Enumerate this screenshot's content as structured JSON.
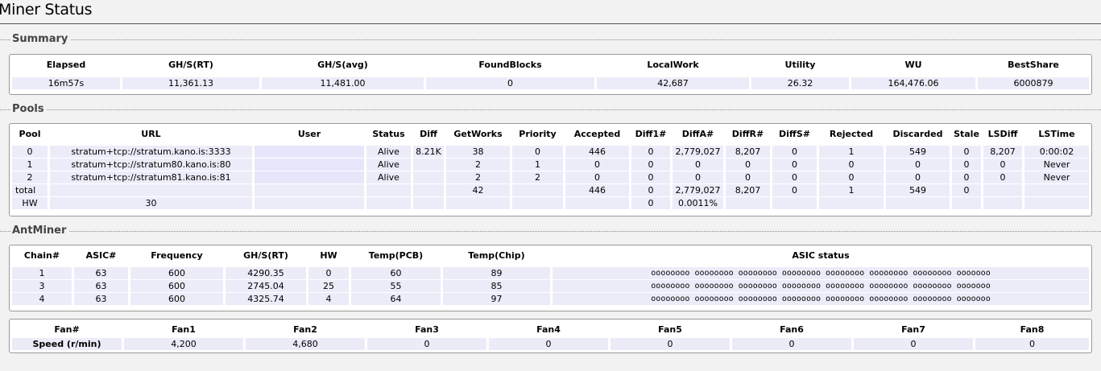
{
  "page": {
    "title": "Miner Status"
  },
  "summary": {
    "legend": "Summary",
    "headers": [
      "Elapsed",
      "GH/S(RT)",
      "GH/S(avg)",
      "FoundBlocks",
      "LocalWork",
      "Utility",
      "WU",
      "BestShare"
    ],
    "values": [
      "16m57s",
      "11,361.13",
      "11,481.00",
      "0",
      "42,687",
      "26.32",
      "164,476.06",
      "6000879"
    ]
  },
  "pools": {
    "legend": "Pools",
    "headers": [
      "Pool",
      "URL",
      "User",
      "Status",
      "Diff",
      "GetWorks",
      "Priority",
      "Accepted",
      "Diff1#",
      "DiffA#",
      "DiffR#",
      "DiffS#",
      "Rejected",
      "Discarded",
      "Stale",
      "LSDiff",
      "LSTime"
    ],
    "rows": [
      [
        "0",
        "stratum+tcp://stratum.kano.is:3333",
        "",
        "Alive",
        "8.21K",
        "38",
        "0",
        "446",
        "0",
        "2,779,027",
        "8,207",
        "0",
        "1",
        "549",
        "0",
        "8,207",
        "0:00:02"
      ],
      [
        "1",
        "stratum+tcp://stratum80.kano.is:80",
        "",
        "Alive",
        "",
        "2",
        "1",
        "0",
        "0",
        "0",
        "0",
        "0",
        "0",
        "0",
        "0",
        "0",
        "Never"
      ],
      [
        "2",
        "stratum+tcp://stratum81.kano.is:81",
        "",
        "Alive",
        "",
        "2",
        "2",
        "0",
        "0",
        "0",
        "0",
        "0",
        "0",
        "0",
        "0",
        "0",
        "Never"
      ],
      [
        "total",
        "",
        "",
        "",
        "",
        "42",
        "",
        "446",
        "0",
        "2,779,027",
        "8,207",
        "0",
        "1",
        "549",
        "0",
        "",
        ""
      ]
    ],
    "hw_row": {
      "label": "HW",
      "value": "30",
      "diff1": "0",
      "diffa": "0.0011%"
    }
  },
  "antminer": {
    "legend": "AntMiner",
    "headers": [
      "Chain#",
      "ASIC#",
      "Frequency",
      "GH/S(RT)",
      "HW",
      "Temp(PCB)",
      "Temp(Chip)",
      "ASIC status"
    ],
    "rows": [
      [
        "1",
        "63",
        "600",
        "4290.35",
        "0",
        "60",
        "89",
        "oooooooo oooooooo oooooooo oooooooo oooooooo oooooooo oooooooo ooooooo"
      ],
      [
        "3",
        "63",
        "600",
        "2745.04",
        "25",
        "55",
        "85",
        "oooooooo oooooooo oooooooo oooooooo oooooooo oooooooo oooooooo ooooooo"
      ],
      [
        "4",
        "63",
        "600",
        "4325.74",
        "4",
        "64",
        "97",
        "oooooooo oooooooo oooooooo oooooooo oooooooo oooooooo oooooooo ooooooo"
      ]
    ],
    "fans": {
      "headers": [
        "Fan#",
        "Fan1",
        "Fan2",
        "Fan3",
        "Fan4",
        "Fan5",
        "Fan6",
        "Fan7",
        "Fan8"
      ],
      "label": "Speed (r/min)",
      "values": [
        "4,200",
        "4,680",
        "0",
        "0",
        "0",
        "0",
        "0",
        "0"
      ]
    }
  }
}
